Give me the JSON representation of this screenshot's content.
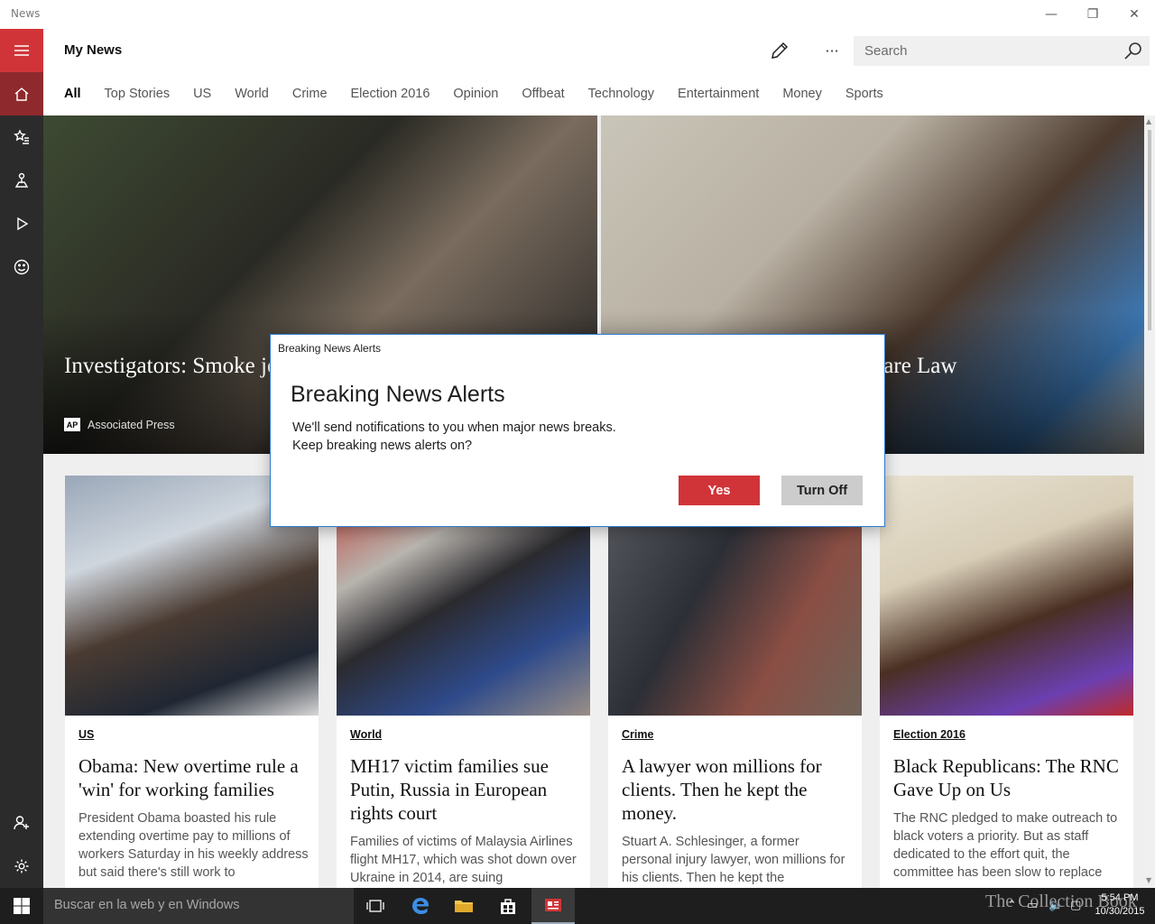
{
  "window": {
    "app_title": "News",
    "minimize_glyph": "—",
    "restore_glyph": "❐",
    "close_glyph": "✕"
  },
  "rail": {
    "items": [
      {
        "icon": "hamburger-menu-icon"
      },
      {
        "icon": "home-icon",
        "active": true
      },
      {
        "icon": "favorites-star-icon"
      },
      {
        "icon": "local-icon"
      },
      {
        "icon": "video-play-icon"
      },
      {
        "icon": "smiley-icon"
      },
      {
        "icon": "add-person-icon"
      },
      {
        "icon": "settings-gear-icon"
      }
    ],
    "accent": "#d13438"
  },
  "header": {
    "title": "My News",
    "more_label": "···",
    "search_placeholder": "Search"
  },
  "tabs": [
    {
      "label": "All",
      "active": true
    },
    {
      "label": "Top Stories"
    },
    {
      "label": "US"
    },
    {
      "label": "World"
    },
    {
      "label": "Crime"
    },
    {
      "label": "Election 2016"
    },
    {
      "label": "Opinion"
    },
    {
      "label": "Offbeat"
    },
    {
      "label": "Technology"
    },
    {
      "label": "Entertainment"
    },
    {
      "label": "Money"
    },
    {
      "label": "Sports"
    }
  ],
  "hero": {
    "left": {
      "headline": "Investigators: Smoke jet just before crash",
      "source": "Associated Press",
      "source_logo": "AP"
    },
    "right": {
      "headline": "lfare Law"
    }
  },
  "cards": [
    {
      "category": "US",
      "title": "Obama: New overtime rule a 'win' for working families",
      "summary": "President Obama boasted his rule extending overtime pay to millions of workers Saturday in his weekly address but said there's still work to"
    },
    {
      "category": "World",
      "title": "MH17 victim families sue Putin, Russia in European rights court",
      "summary": "Families of victims of Malaysia Airlines flight MH17, which was shot down over Ukraine in 2014, are suing"
    },
    {
      "category": "Crime",
      "title": "A lawyer won millions for clients. Then he kept the money.",
      "summary": "Stuart A. Schlesinger, a former personal injury lawyer, won millions for his clients. Then he kept the"
    },
    {
      "category": "Election 2016",
      "title": "Black Republicans: The RNC Gave Up on Us",
      "summary": "The RNC pledged to make outreach to black voters a priority. But as staff dedicated to the effort quit, the committee has been slow to replace"
    }
  ],
  "dialog": {
    "caption": "Breaking News Alerts",
    "title": "Breaking News Alerts",
    "message_line1": "We'll send notifications to you when major news breaks.",
    "message_line2": "Keep breaking news alerts on?",
    "yes_label": "Yes",
    "off_label": "Turn Off"
  },
  "taskbar": {
    "search_placeholder": "Buscar en la web y en Windows",
    "watermark": "The Collection Book",
    "time": "5:54 PM",
    "date": "10/30/2015"
  }
}
